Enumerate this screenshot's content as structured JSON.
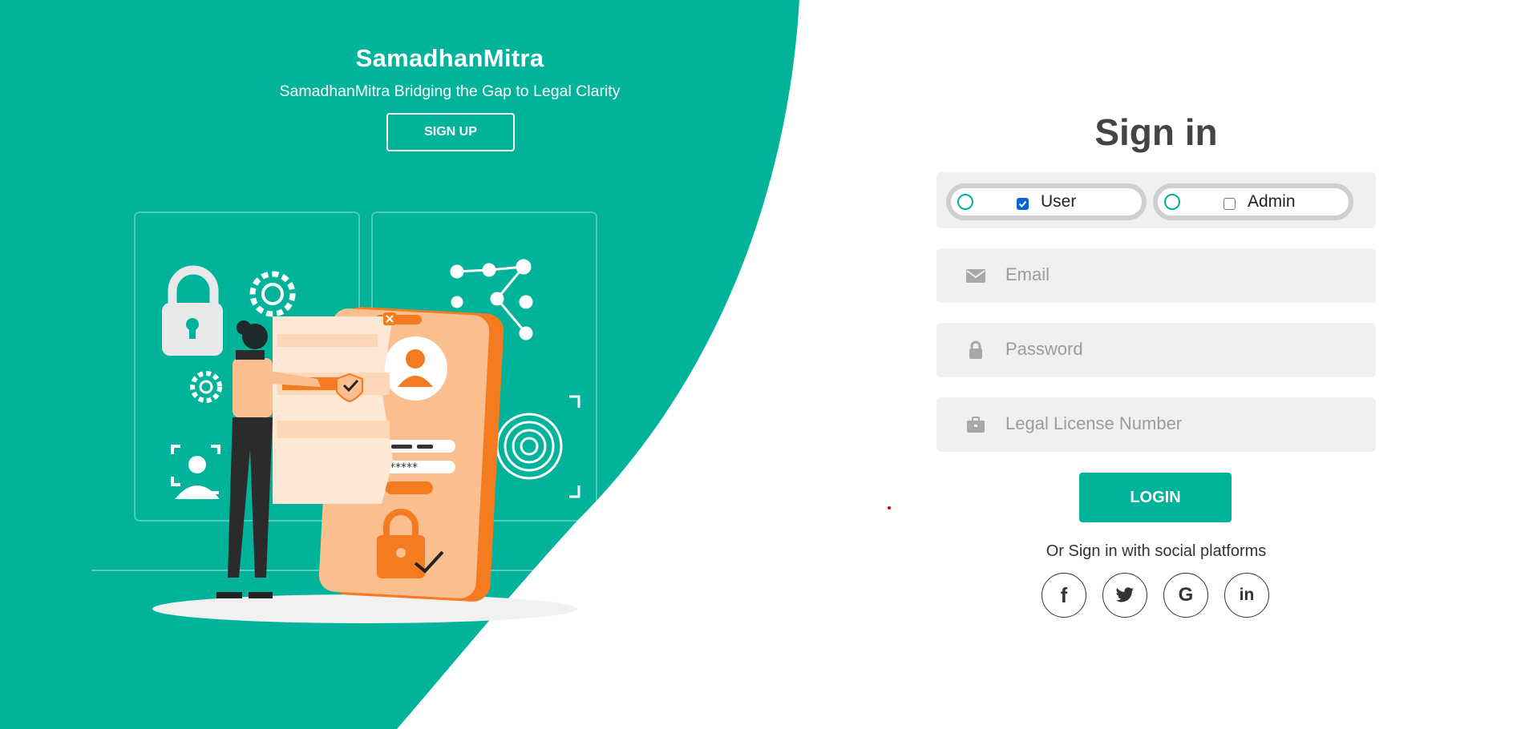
{
  "brand": {
    "title": "SamadhanMitra",
    "subtitle": "SamadhanMitra Bridging the Gap to Legal Clarity",
    "signup_label": "SIGN UP"
  },
  "colors": {
    "accent": "#00b39a",
    "illustration_orange": "#f47b20",
    "illustration_peach": "#fbbf8f",
    "text_dark": "#444444",
    "field_bg": "#f0f0f0",
    "placeholder": "#9c9c9c"
  },
  "form": {
    "title": "Sign in",
    "roles": [
      {
        "label": "User",
        "checked": true
      },
      {
        "label": "Admin",
        "checked": false
      }
    ],
    "fields": [
      {
        "icon": "envelope-icon",
        "placeholder": "Email"
      },
      {
        "icon": "lock-icon",
        "placeholder": "Password"
      },
      {
        "icon": "briefcase-icon",
        "placeholder": "Legal License Number"
      }
    ],
    "login_label": "LOGIN",
    "social_label": "Or Sign in with social platforms",
    "social": [
      {
        "icon": "facebook-icon",
        "glyph": "f"
      },
      {
        "icon": "twitter-icon",
        "glyph": ""
      },
      {
        "icon": "google-icon",
        "glyph": "G"
      },
      {
        "icon": "linkedin-icon",
        "glyph": "in"
      }
    ]
  }
}
